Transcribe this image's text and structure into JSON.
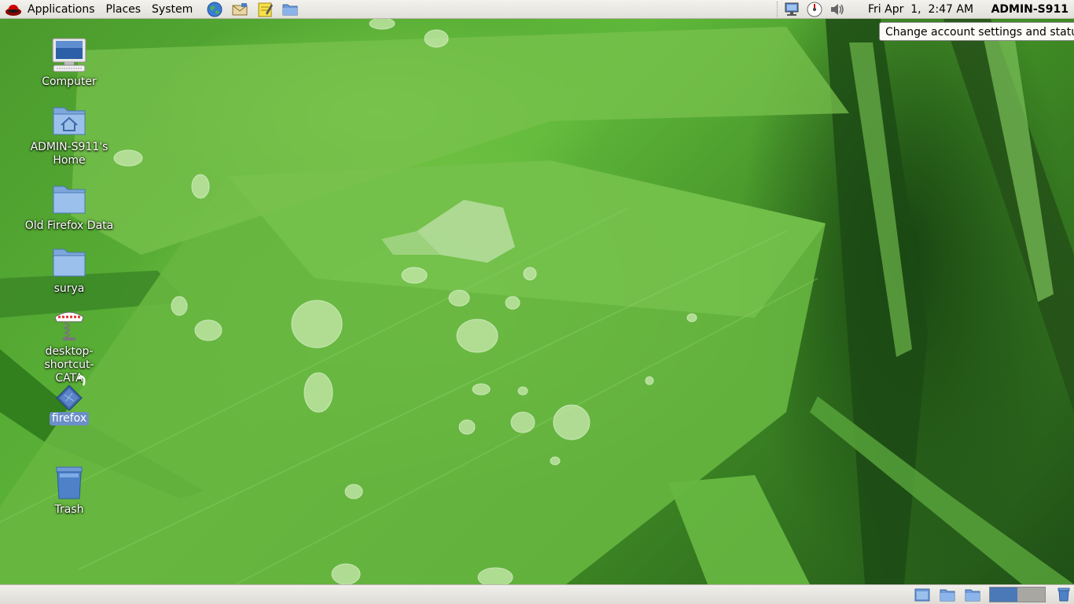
{
  "top_panel": {
    "menus": [
      "Applications",
      "Places",
      "System"
    ],
    "launchers": [
      "web-browser-icon",
      "mail-icon",
      "notes-editor-icon",
      "file-manager-icon"
    ],
    "tray_icons": [
      "network-icon",
      "update-gauge-icon",
      "volume-icon"
    ],
    "clock": "Fri Apr  1,  2:47 AM",
    "username": "ADMIN-S911"
  },
  "tooltip": "Change account settings and status",
  "desktop": {
    "icons": [
      {
        "label": "Computer",
        "icon": "computer-icon"
      },
      {
        "label": "ADMIN-S911's Home",
        "label_line1": "ADMIN-S911's",
        "label_line2": "Home",
        "icon": "home-folder-icon"
      },
      {
        "label": "Old Firefox Data",
        "icon": "folder-icon"
      },
      {
        "label": "surya",
        "icon": "folder-icon"
      },
      {
        "label": "desktop-shortcut-CATA",
        "label_line1": "desktop-shortcut-",
        "label_line2": "CATA",
        "icon": "cata-shortcut-icon"
      },
      {
        "label": "firefox",
        "icon": "firefox-shortcut-icon",
        "selected": true
      },
      {
        "label": "Trash",
        "icon": "trash-icon"
      }
    ]
  },
  "bottom_panel": {
    "items": [
      "show-desktop-icon",
      "window-list-folder-icon",
      "window-list-folder-icon"
    ],
    "workspaces": 2,
    "active_workspace": 1
  },
  "colors": {
    "panel_bg": "#e8e6e1",
    "selection": "#6b8fc8",
    "workspace_active": "#4b78b6"
  }
}
